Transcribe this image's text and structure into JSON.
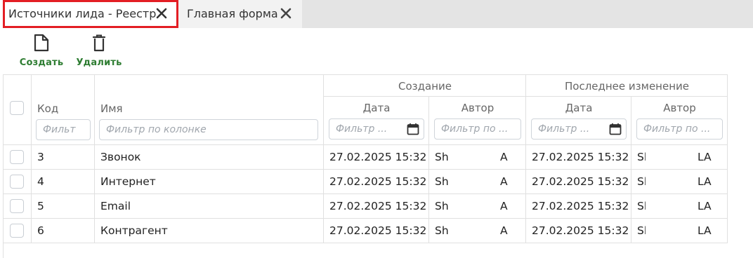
{
  "tabs": [
    {
      "label": "Источники лида - Реестр",
      "active": true
    },
    {
      "label": "Главная форма",
      "active": false
    }
  ],
  "toolbar": {
    "create_label": "Создать",
    "delete_label": "Удалить"
  },
  "table": {
    "group_headers": {
      "creation": "Создание",
      "last_change": "Последнее изменение"
    },
    "columns": {
      "code": "Код",
      "name": "Имя",
      "created_date": "Дата",
      "created_author": "Автор",
      "changed_date": "Дата",
      "changed_author": "Автор"
    },
    "filters": {
      "code": "Фильт",
      "name": "Фильтр по колонке",
      "created_date": "Фильтр ...",
      "created_author": "Фильтр по ...",
      "changed_date": "Фильтр ...",
      "changed_author": "Фильтр по ..."
    },
    "rows": [
      {
        "code": "3",
        "name": "Звонок",
        "created_date": "27.02.2025 15:32",
        "created_author_a": "Sh",
        "created_author_b": "A",
        "changed_date": "27.02.2025 15:32",
        "changed_author_a": "Sh",
        "changed_author_b": "LA"
      },
      {
        "code": "4",
        "name": "Интернет",
        "created_date": "27.02.2025 15:32",
        "created_author_a": "Sh",
        "created_author_b": "A",
        "changed_date": "27.02.2025 15:32",
        "changed_author_a": "Sh",
        "changed_author_b": "LA"
      },
      {
        "code": "5",
        "name": "Email",
        "created_date": "27.02.2025 15:32",
        "created_author_a": "Sh",
        "created_author_b": "A",
        "changed_date": "27.02.2025 15:32",
        "changed_author_a": "Sh",
        "changed_author_b": "LA"
      },
      {
        "code": "6",
        "name": "Контрагент",
        "created_date": "27.02.2025 15:32",
        "created_author_a": "Sh",
        "created_author_b": "A",
        "changed_date": "27.02.2025 15:32",
        "changed_author_a": "Sh",
        "changed_author_b": "LA"
      }
    ]
  },
  "colors": {
    "accent_green": "#2e7d32",
    "highlight_red": "#e31e24",
    "tabbar_bg": "#e4e4e4"
  }
}
